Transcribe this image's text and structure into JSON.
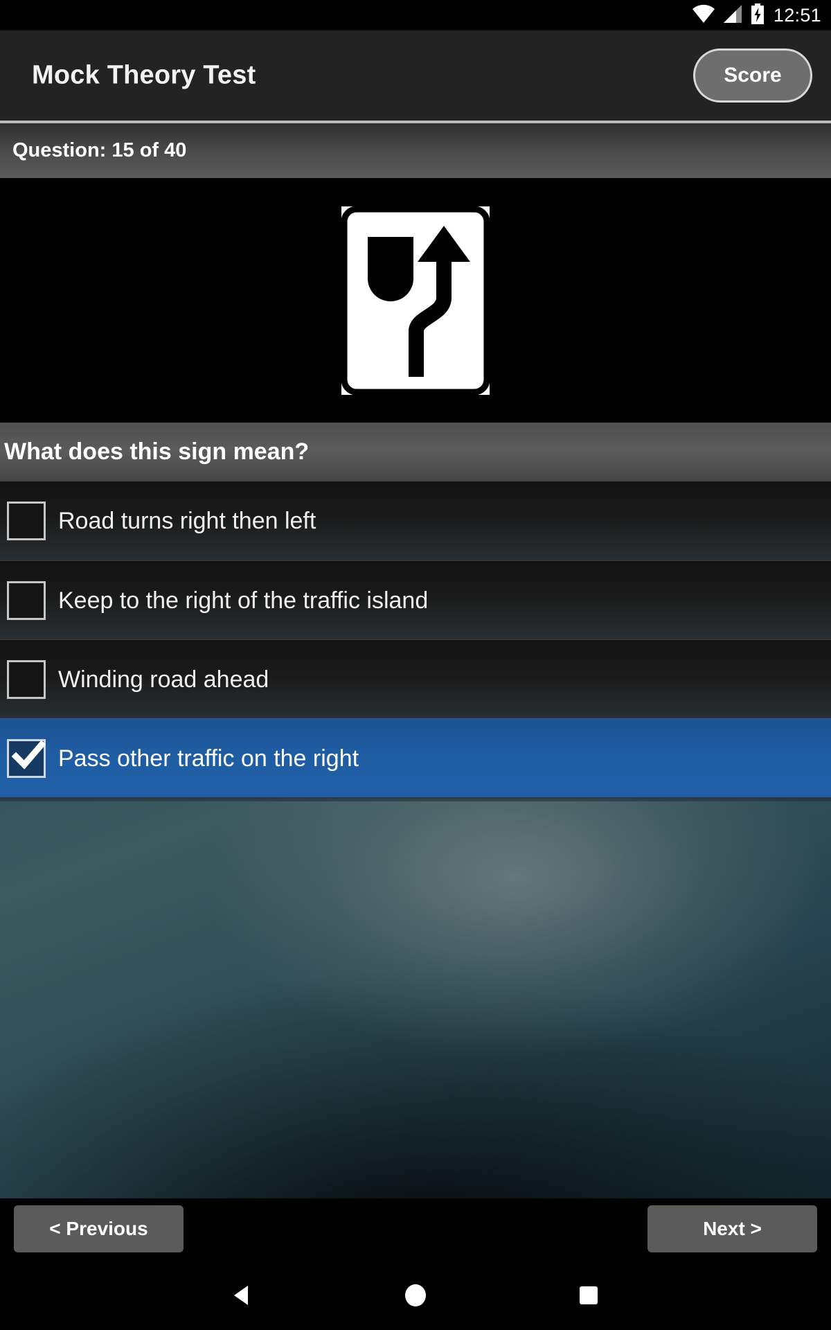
{
  "statusbar": {
    "clock": "12:51",
    "icons": [
      "wifi-icon",
      "cellular-signal-icon",
      "battery-charging-icon"
    ]
  },
  "appbar": {
    "title": "Mock Theory Test",
    "score_label": "Score"
  },
  "quiz": {
    "counter_text": "Question: 15 of 40",
    "current_question": 15,
    "total_questions": 40,
    "question_text": "What does this sign mean?",
    "sign_icon": "keep-right-pass-either-side-sign",
    "options": [
      {
        "label": "Road turns right then left",
        "checked": false
      },
      {
        "label": "Keep to the right of the traffic island",
        "checked": false
      },
      {
        "label": "Winding road ahead",
        "checked": false
      },
      {
        "label": "Pass other traffic on the right",
        "checked": true
      }
    ]
  },
  "navigation": {
    "previous_label": "< Previous",
    "next_label": "Next >"
  },
  "system_nav": {
    "back": "back-triangle-icon",
    "home": "home-circle-icon",
    "recents": "recents-square-icon"
  },
  "colors": {
    "accent_selected": "#1f5da3",
    "appbar_bg": "#232323",
    "button_bg": "#5b5b5b",
    "text_primary": "#ffffff"
  }
}
